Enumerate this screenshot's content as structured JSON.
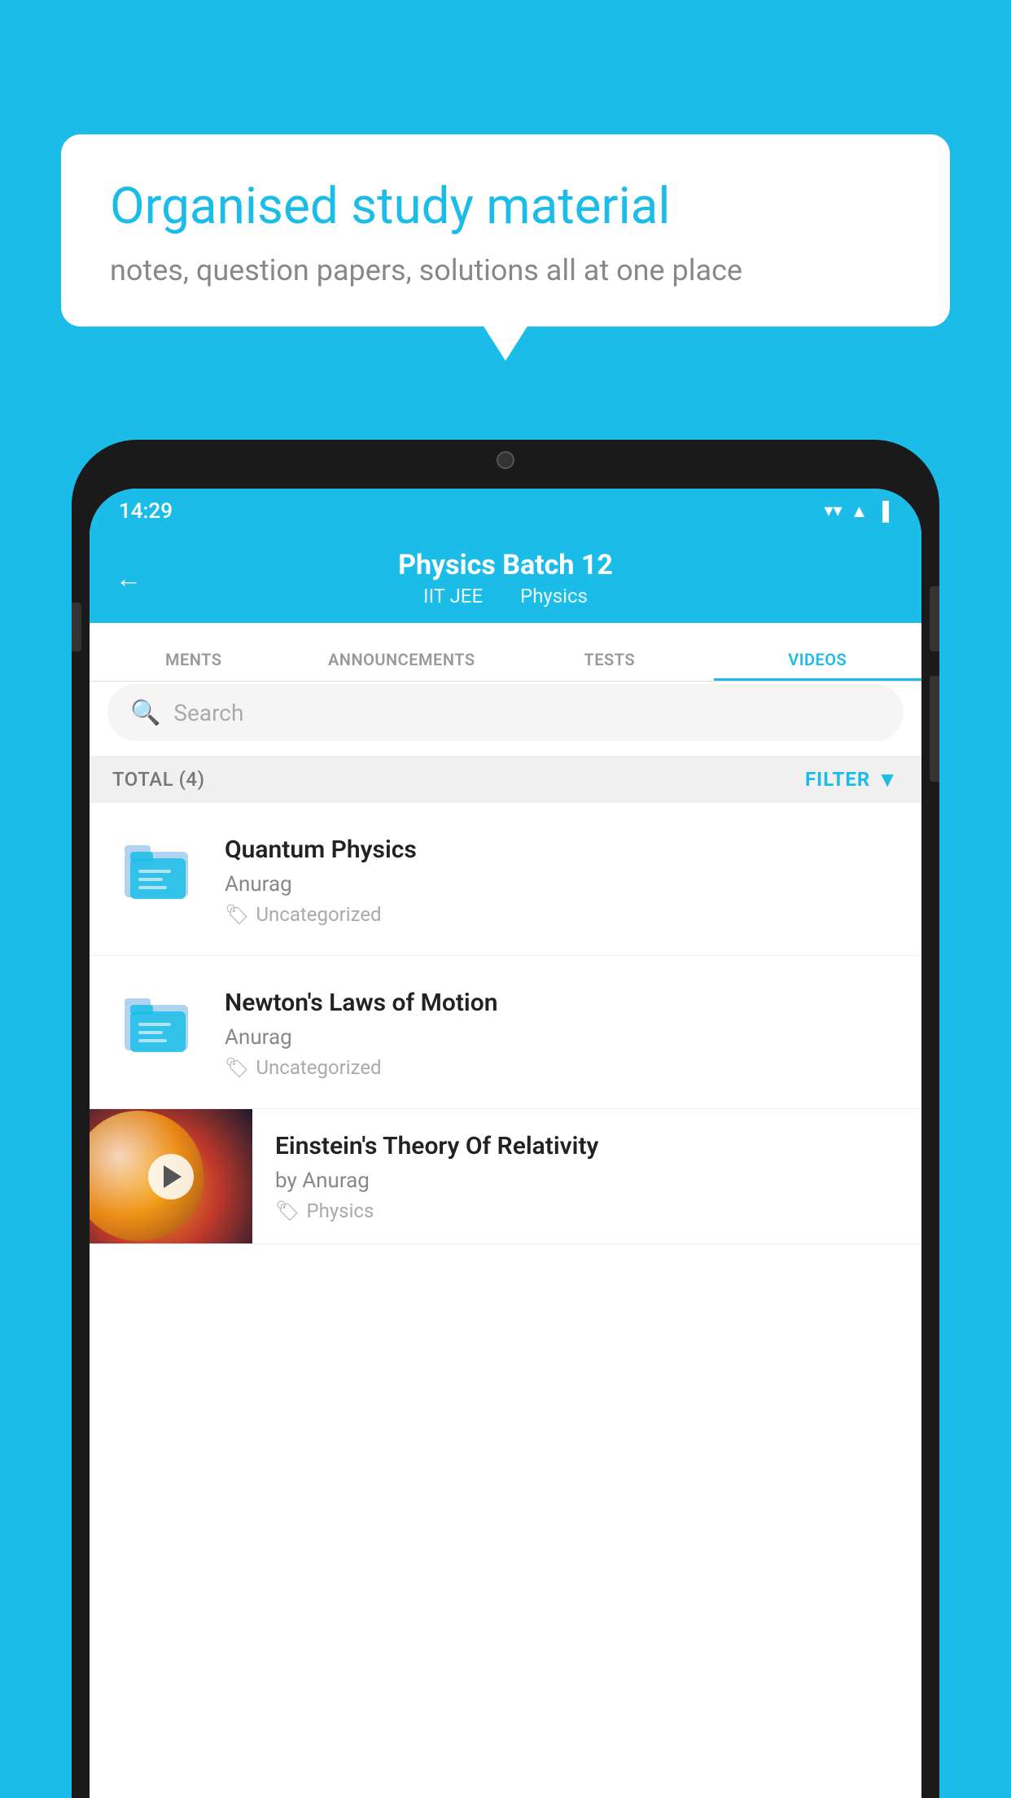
{
  "background": {
    "color": "#1bbde8"
  },
  "speech_bubble": {
    "title": "Organised study material",
    "subtitle": "notes, question papers, solutions all at one place"
  },
  "status_bar": {
    "time": "14:29",
    "wifi": "▼",
    "signal": "▲",
    "battery": "▌"
  },
  "app_header": {
    "back_label": "←",
    "title": "Physics Batch 12",
    "subtitle_part1": "IIT JEE",
    "subtitle_part2": "Physics"
  },
  "tabs": [
    {
      "label": "MENTS",
      "active": false
    },
    {
      "label": "ANNOUNCEMENTS",
      "active": false
    },
    {
      "label": "TESTS",
      "active": false
    },
    {
      "label": "VIDEOS",
      "active": true
    }
  ],
  "search": {
    "placeholder": "Search"
  },
  "filter_bar": {
    "total_label": "TOTAL (4)",
    "filter_label": "FILTER"
  },
  "video_items": [
    {
      "id": 1,
      "title": "Quantum Physics",
      "author": "Anurag",
      "tag": "Uncategorized",
      "has_thumbnail": false
    },
    {
      "id": 2,
      "title": "Newton's Laws of Motion",
      "author": "Anurag",
      "tag": "Uncategorized",
      "has_thumbnail": false
    },
    {
      "id": 3,
      "title": "Einstein's Theory Of Relativity",
      "author": "by Anurag",
      "tag": "Physics",
      "has_thumbnail": true
    }
  ]
}
